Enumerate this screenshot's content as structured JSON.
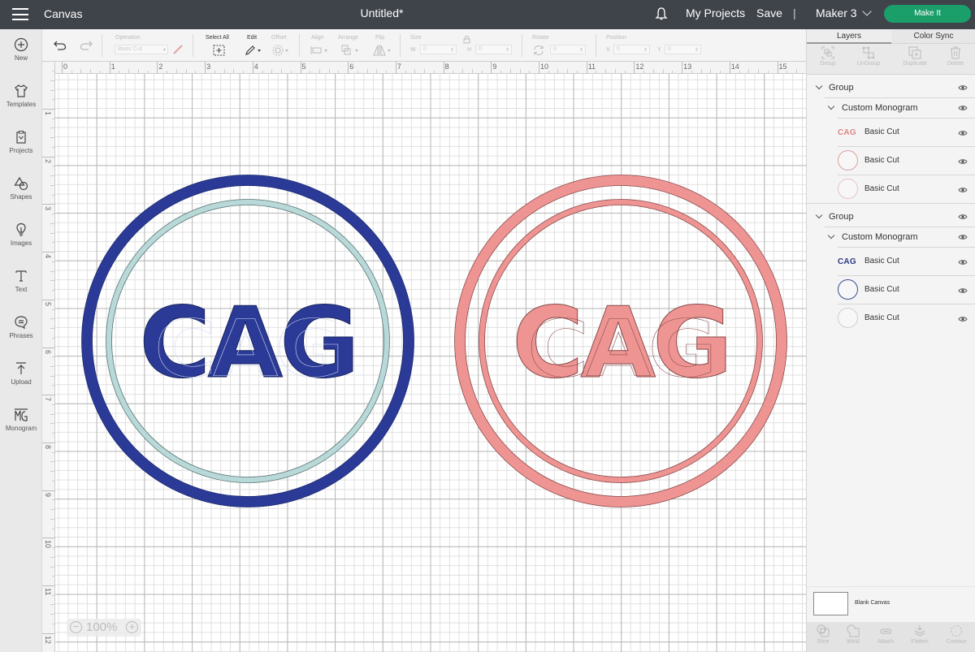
{
  "topbar": {
    "app_title": "Canvas",
    "doc_title": "Untitled*",
    "my_projects": "My Projects",
    "save": "Save",
    "separator": "|",
    "machine": "Maker 3",
    "make_it": "Make It"
  },
  "sidebar": {
    "items": [
      {
        "label": "New",
        "icon": "plus-circle-icon"
      },
      {
        "label": "Templates",
        "icon": "tshirt-icon"
      },
      {
        "label": "Projects",
        "icon": "projects-icon"
      },
      {
        "label": "Shapes",
        "icon": "shapes-icon"
      },
      {
        "label": "Images",
        "icon": "lightbulb-icon"
      },
      {
        "label": "Text",
        "icon": "text-icon"
      },
      {
        "label": "Phrases",
        "icon": "speech-bubble-icon"
      },
      {
        "label": "Upload",
        "icon": "upload-icon"
      },
      {
        "label": "Monogram",
        "icon": "monogram-icon"
      }
    ]
  },
  "toolbar": {
    "operation_label": "Operation",
    "operation_value": "Basic Cut",
    "select_all_label": "Select All",
    "edit_label": "Edit",
    "offset_label": "Offset",
    "align_label": "Align",
    "arrange_label": "Arrange",
    "flip_label": "Flip",
    "size_label": "Size",
    "w_label": "W",
    "w_value": "0",
    "h_label": "H",
    "h_value": "0",
    "rotate_label": "Rotate",
    "rotate_value": "0",
    "position_label": "Position",
    "x_label": "X",
    "x_value": "0",
    "y_label": "Y",
    "y_value": "0"
  },
  "rulers": {
    "horizontal": [
      "0",
      "1",
      "2",
      "3",
      "4",
      "5",
      "6",
      "7",
      "8",
      "9",
      "10",
      "11",
      "12",
      "13",
      "14",
      "15"
    ],
    "vertical": [
      "1",
      "2",
      "3",
      "4",
      "5",
      "6",
      "7",
      "8",
      "9",
      "10",
      "11",
      "12"
    ]
  },
  "canvas": {
    "zoom": "100%",
    "designs": [
      {
        "name": "blue-monogram",
        "text": "CAG",
        "outer_ring_color": "#2a3a96",
        "inner_ring_color": "#b9d8d8",
        "text_color": "#2a3a96"
      },
      {
        "name": "pink-monogram",
        "text": "CAG",
        "outer_ring_color": "#ee9593",
        "inner_ring_color": "#ee9593",
        "text_color": "#ee9593"
      }
    ]
  },
  "panel": {
    "tabs": [
      "Layers",
      "Color Sync"
    ],
    "actions": [
      "Group",
      "UnGroup",
      "Duplicate",
      "Delete"
    ],
    "layers": [
      {
        "type": "group",
        "label": "Group"
      },
      {
        "type": "subgroup",
        "label": "Custom Monogram"
      },
      {
        "type": "text",
        "thumb": "CAG",
        "color": "#e08585",
        "label": "Basic Cut"
      },
      {
        "type": "circle",
        "color": "#e0a0a0",
        "label": "Basic Cut"
      },
      {
        "type": "circle",
        "color": "#e6c4c4",
        "label": "Basic Cut"
      },
      {
        "type": "group",
        "label": "Group"
      },
      {
        "type": "subgroup",
        "label": "Custom Monogram"
      },
      {
        "type": "text",
        "thumb": "CAG",
        "color": "#2a3a86",
        "label": "Basic Cut"
      },
      {
        "type": "circle",
        "color": "#3a4a90",
        "label": "Basic Cut"
      },
      {
        "type": "circle",
        "color": "#cfcfcf",
        "label": "Basic Cut"
      }
    ],
    "blank_canvas": "Blank Canvas",
    "bottom_actions": [
      "Slice",
      "Weld",
      "Attach",
      "Flatten",
      "Contour"
    ]
  }
}
